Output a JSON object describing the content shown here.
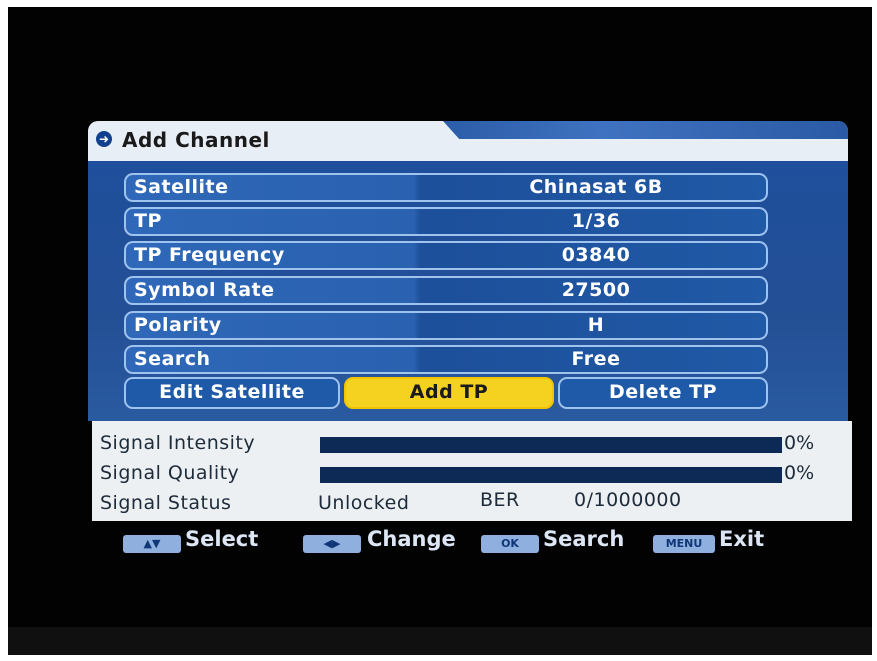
{
  "title": {
    "icon": "arrow-circle-icon",
    "text": "Add Channel"
  },
  "rows": [
    {
      "label": "Satellite",
      "value": "Chinasat 6B"
    },
    {
      "label": "TP",
      "value": "1/36"
    },
    {
      "label": "TP Frequency",
      "value": "03840"
    },
    {
      "label": "Symbol Rate",
      "value": "27500"
    },
    {
      "label": "Polarity",
      "value": "H"
    },
    {
      "label": "Search",
      "value": "Free"
    }
  ],
  "buttons": {
    "edit_satellite": "Edit Satellite",
    "add_tp": "Add TP",
    "delete_tp": "Delete TP"
  },
  "signal": {
    "intensity_label": "Signal Intensity",
    "intensity_pct": "0%",
    "intensity_value": 0,
    "quality_label": "Signal Quality",
    "quality_pct": "0%",
    "quality_value": 0,
    "status_label": "Signal Status",
    "status_value": "Unlocked",
    "ber_label": "BER",
    "ber_value": "0/1000000"
  },
  "hints": {
    "select": "Select",
    "change": "Change",
    "ok_key": "OK",
    "search": "Search",
    "menu_key": "MENU",
    "exit": "Exit"
  },
  "colors": {
    "panel_blue": "#1f4f9c",
    "active_button": "#f5d21f",
    "bar_track": "#0d2a57"
  }
}
